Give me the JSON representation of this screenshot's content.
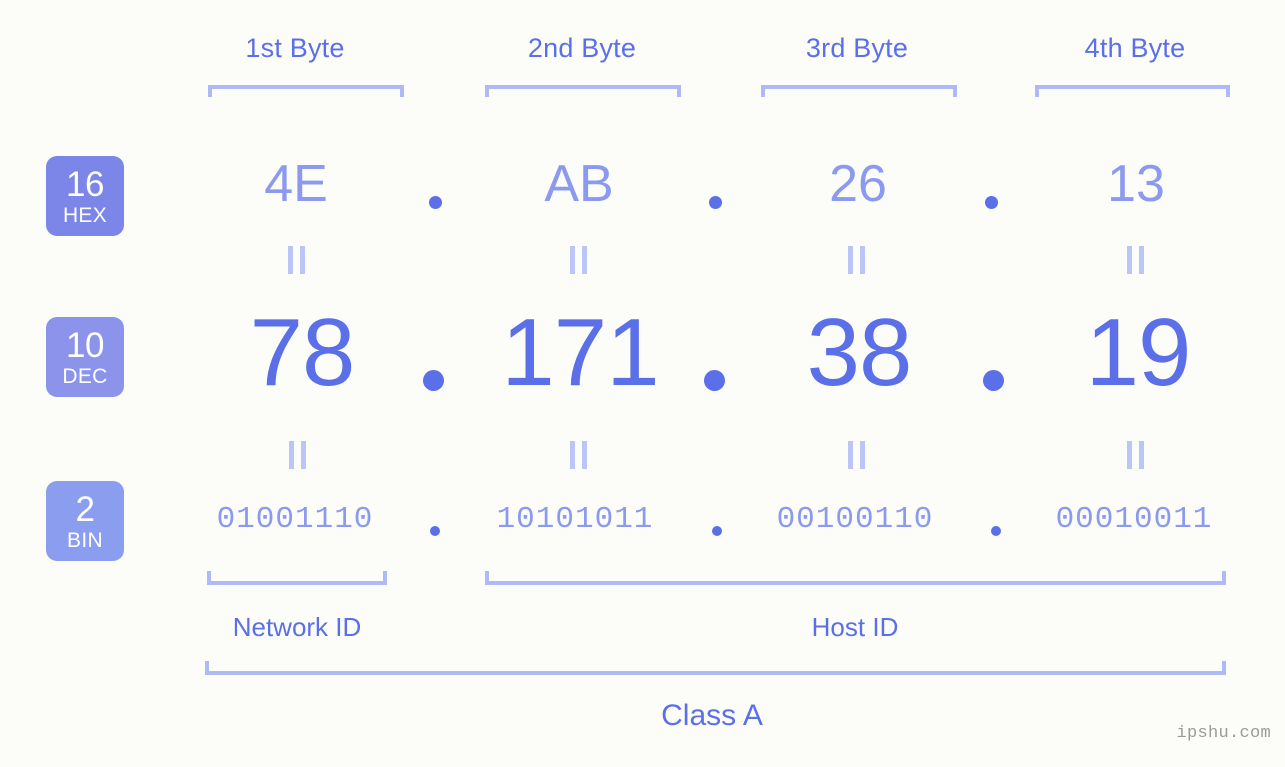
{
  "page": {
    "background_color": "#fcfdf8",
    "accent_color": "#5a6fe8",
    "accent_light_color": "#8b9aef",
    "bracket_color": "#aeb9f5",
    "watermark": "ipshu.com"
  },
  "byte_headers": [
    {
      "label": "1st Byte"
    },
    {
      "label": "2nd Byte"
    },
    {
      "label": "3rd Byte"
    },
    {
      "label": "4th Byte"
    }
  ],
  "rows": {
    "hex": {
      "badge": {
        "base": "16",
        "name": "HEX",
        "color": "#7b86e8"
      },
      "values": [
        "4E",
        "AB",
        "26",
        "13"
      ],
      "separator": "."
    },
    "dec": {
      "badge": {
        "base": "10",
        "name": "DEC",
        "color": "#8b94ea"
      },
      "values": [
        "78",
        "171",
        "38",
        "19"
      ],
      "separator": "."
    },
    "bin": {
      "badge": {
        "base": "2",
        "name": "BIN",
        "color": "#8b9def"
      },
      "values": [
        "01001110",
        "10101011",
        "00100110",
        "00010011"
      ],
      "separator": "."
    }
  },
  "equality_marks": {
    "hex_to_dec": [
      "=",
      "=",
      "=",
      "="
    ],
    "dec_to_bin": [
      "=",
      "=",
      "=",
      "="
    ]
  },
  "segments": {
    "network_id": {
      "label": "Network ID"
    },
    "host_id": {
      "label": "Host ID"
    }
  },
  "class": {
    "label": "Class A"
  }
}
